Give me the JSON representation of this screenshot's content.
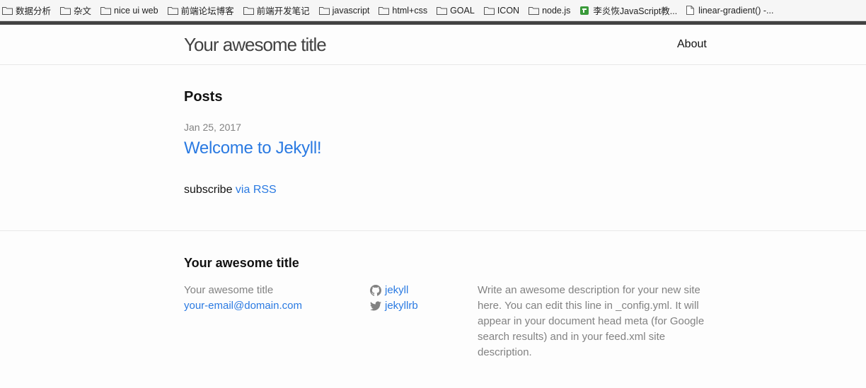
{
  "bookmarks": [
    {
      "label": "数据分析",
      "icon": "folder-icon"
    },
    {
      "label": "杂文",
      "icon": "folder-icon"
    },
    {
      "label": "nice ui web",
      "icon": "folder-icon"
    },
    {
      "label": "前端论坛博客",
      "icon": "folder-icon"
    },
    {
      "label": "前端开发笔记",
      "icon": "folder-icon"
    },
    {
      "label": "javascript",
      "icon": "folder-icon"
    },
    {
      "label": "html+css",
      "icon": "folder-icon"
    },
    {
      "label": "GOAL",
      "icon": "folder-icon"
    },
    {
      "label": "ICON",
      "icon": "folder-icon"
    },
    {
      "label": "node.js",
      "icon": "folder-icon"
    },
    {
      "label": "李炎恢JavaScript教...",
      "icon": "green-extension-icon"
    },
    {
      "label": "linear-gradient() -...",
      "icon": "page-icon"
    }
  ],
  "header": {
    "site_title": "Your awesome title",
    "nav": {
      "about": "About"
    }
  },
  "main": {
    "heading": "Posts",
    "posts": [
      {
        "date": "Jan 25, 2017",
        "title": "Welcome to Jekyll!"
      }
    ],
    "rss": {
      "prefix": "subscribe ",
      "link": "via RSS"
    }
  },
  "footer": {
    "heading": "Your awesome title",
    "name": "Your awesome title",
    "email": "your-email@domain.com",
    "github": "jekyll",
    "twitter": "jekyllrb",
    "description": "Write an awesome description for your new site here. You can edit this line in _config.yml. It will appear in your document head meta (for Google search results) and in your feed.xml site description."
  },
  "colors": {
    "link": "#2a7ae2",
    "muted": "#828282",
    "text": "#111111",
    "background": "#fdfdfd"
  }
}
